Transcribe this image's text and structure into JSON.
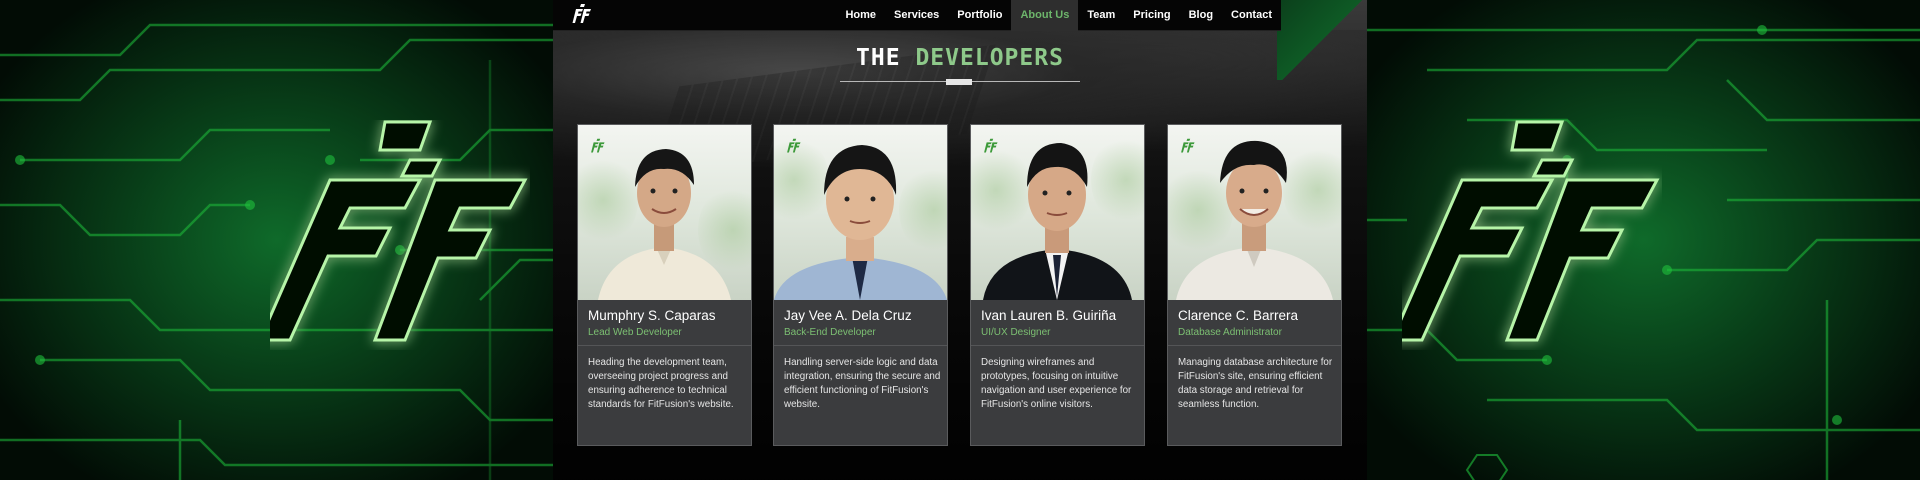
{
  "nav": {
    "links": [
      {
        "label": "Home",
        "active": false
      },
      {
        "label": "Services",
        "active": false
      },
      {
        "label": "Portfolio",
        "active": false
      },
      {
        "label": "About Us",
        "active": true
      },
      {
        "label": "Team",
        "active": false
      },
      {
        "label": "Pricing",
        "active": false
      },
      {
        "label": "Blog",
        "active": false
      },
      {
        "label": "Contact",
        "active": false
      }
    ],
    "active_color": "#6db56b"
  },
  "section": {
    "title_part1": "THE",
    "title_part2": "DEVELOPERS",
    "accent_color": "#8ec98a"
  },
  "team": [
    {
      "name": "Mumphry S. Caparas",
      "role": "Lead Web Developer",
      "description": "Heading the development team, overseeing project progress and ensuring adherence to technical standards for FitFusion's website.",
      "attire": "barong"
    },
    {
      "name": "Jay Vee A. Dela Cruz",
      "role": "Back-End Developer",
      "description": "Handling server-side logic and data integration, ensuring the secure and efficient functioning of FitFusion's website.",
      "attire": "blue-shirt-tie"
    },
    {
      "name": "Ivan Lauren B. Guiriña",
      "role": "UI/UX Designer",
      "description": "Designing wireframes and prototypes, focusing on intuitive navigation and user experience for FitFusion's online visitors.",
      "attire": "black-suit"
    },
    {
      "name": "Clarence C. Barrera",
      "role": "Database Administrator",
      "description": "Managing database architecture for FitFusion's site, ensuring efficient data storage and retrieval for seamless function.",
      "attire": "white-shirt"
    }
  ],
  "colors": {
    "role_green": "#7cbf72",
    "card_bg": "#3b3c3e",
    "circuit_green": "#1fbf3c"
  },
  "icons": {
    "brand_logo": "ff-logo-icon"
  }
}
